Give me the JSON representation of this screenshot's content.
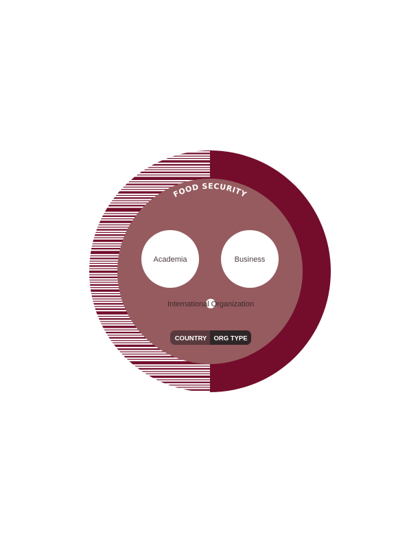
{
  "title": "FOOD SECURITY",
  "colors": {
    "outer_ring": "#730d2b",
    "inner_circle": "#965b5f",
    "bubble_fill": "#ffffff",
    "toggle_inactive": "#5a3a3d",
    "toggle_active": "#2f2628"
  },
  "bubbles": [
    {
      "label": "Academia"
    },
    {
      "label": "Business"
    },
    {
      "label": "International Organization"
    }
  ],
  "toggle": {
    "options": [
      "COUNTRY",
      "ORG TYPE"
    ],
    "selected": "ORG TYPE"
  }
}
